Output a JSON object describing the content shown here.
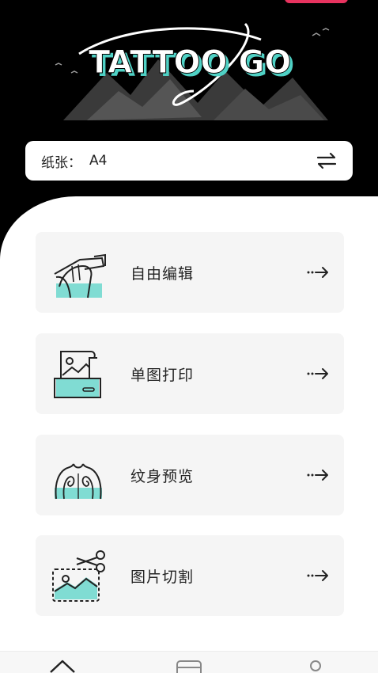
{
  "app": {
    "logo_text": "TATTOO GO"
  },
  "paper": {
    "label": "纸张：",
    "value": "A4"
  },
  "menu": [
    {
      "label": "自由编辑",
      "icon": "hands-stencil-icon"
    },
    {
      "label": "单图打印",
      "icon": "photo-printer-icon"
    },
    {
      "label": "纹身预览",
      "icon": "body-back-preview-icon"
    },
    {
      "label": "图片切割",
      "icon": "image-scissors-icon"
    }
  ],
  "tabbar": {
    "items": [
      {
        "icon": "home-icon"
      },
      {
        "icon": "card-icon"
      },
      {
        "icon": "profile-icon"
      }
    ]
  },
  "colors": {
    "accent": "#4fd1c5",
    "header_bg": "#000000",
    "card_bg": "#f5f5f5",
    "top_pill": "#e8335f"
  }
}
